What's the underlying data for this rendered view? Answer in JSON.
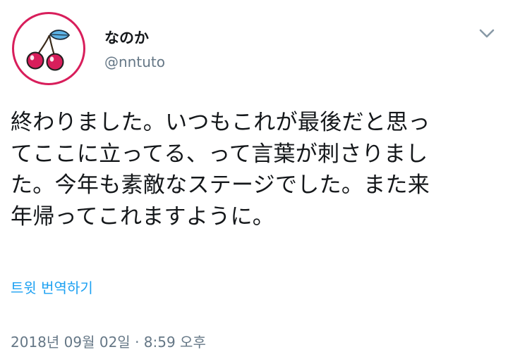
{
  "user": {
    "display_name": "なのか",
    "handle": "@nntuto",
    "avatar_icon": "cherry-icon",
    "avatar_border_color": "#d81e5b"
  },
  "menu": {
    "icon": "chevron-down-icon"
  },
  "tweet": {
    "lines": [
      "終わりました。いつもこれが最後だと思っ",
      "てここに立ってる、って言葉が刺さりまし",
      "た。今年も素敵なステージでした。また来",
      "年帰ってこれますように。"
    ],
    "translate_label": "트윗 번역하기",
    "timestamp": "2018년 09월 02일 · 8:59 오후"
  },
  "colors": {
    "link": "#1da1f2",
    "secondary_text": "#657786",
    "primary_text": "#14171a"
  }
}
